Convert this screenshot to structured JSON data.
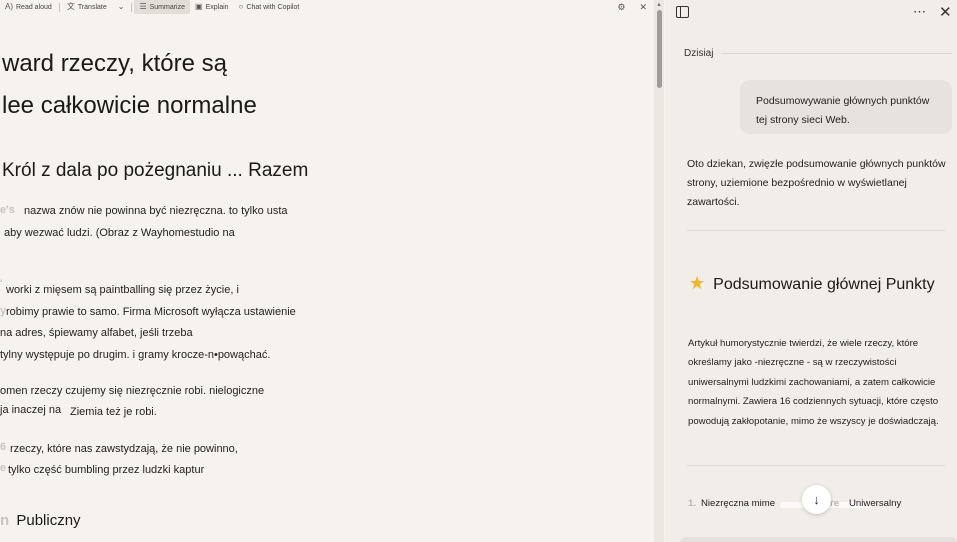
{
  "toolbar": {
    "read_aloud": "Read aloud",
    "translate": "Translate",
    "summarize": "Summarize",
    "explain": "Explain",
    "chat_with_copilot": "Chat with Copilot"
  },
  "article": {
    "title_line1": "ward rzeczy, które są",
    "title_line2": "lee całkowicie normalne",
    "subtitle": "Król z dala po pożegnaniu ... Razem",
    "para1_faint": "e's",
    "para1_line1": "nazwa znów nie powinna być niezręczna. to tylko usta",
    "para1_line2": "aby wezwać ludzi. (Obraz z Wayhomestudio na",
    "para2_faint1": "'",
    "para2_line1": "worki z mięsem są paintballing się przez życie, i",
    "para2_faint2": "y",
    "para2_line2": "robimy prawie to samo. Firma Microsoft wyłącza ustawienie",
    "para2_line3": "na adres, śpiewamy alfabet, jeśli trzeba",
    "para2_line4": "tylny występuje po drugim. i gramy krocze-n•powąchać.",
    "para3_line1": "omen rzeczy czujemy się niezręcznie robi. nielogiczne",
    "para3_line2a": "ja inaczej na",
    "para3_line2b": "Ziemia też je robi.",
    "para4_faint1": "6",
    "para4_line1": "rzeczy, które nas zawstydzają, że nie powinno,",
    "para4_faint2": "e",
    "para4_line2": "tylko część bumbling przez ludzki kaptur",
    "section_faint": "n",
    "section_heading": "Publiczny"
  },
  "copilot": {
    "date_label": "Dzisiaj",
    "user_message": "Podsumowywanie głównych punktów tej strony sieci Web.",
    "response_intro": "Oto dziekan, zwięzłe podsumowanie głównych punktów strony, uziemione bezpośrednio w wyświetlanej zawartości.",
    "summary_title": "Podsumowanie głównej Punkty",
    "summary_body": "Artykuł humorystycznie twierdzi, że wiele rzeczy, które określamy jako -niezręczne - są w rzeczywistości uniwersalnymi ludzkimi zachowaniami, a zatem całkowicie normalnymi. Zawiera 16 codziennych sytuacji, które często powodują zakłopotanie, mimo że wszyscy je doświadczają.",
    "list_num": "1.",
    "list_item_a": "Niezręczna mime",
    "list_item_faint": "re",
    "list_item_b": "Uniwersalny"
  },
  "icons": {
    "read_aloud": "read-aloud-icon",
    "translate": "translate-icon",
    "summarize": "summarize-icon",
    "explain": "explain-icon",
    "chat": "chat-icon",
    "settings": "gear-icon",
    "close": "close-icon",
    "sidebar": "sidebar-toggle-icon",
    "more": "more-icon",
    "star": "star-icon",
    "scroll_down": "arrow-down-icon"
  },
  "colors": {
    "reader_bg": "#f6f3ee",
    "pane_bg": "#f1ede8",
    "star": "#f0b429"
  }
}
